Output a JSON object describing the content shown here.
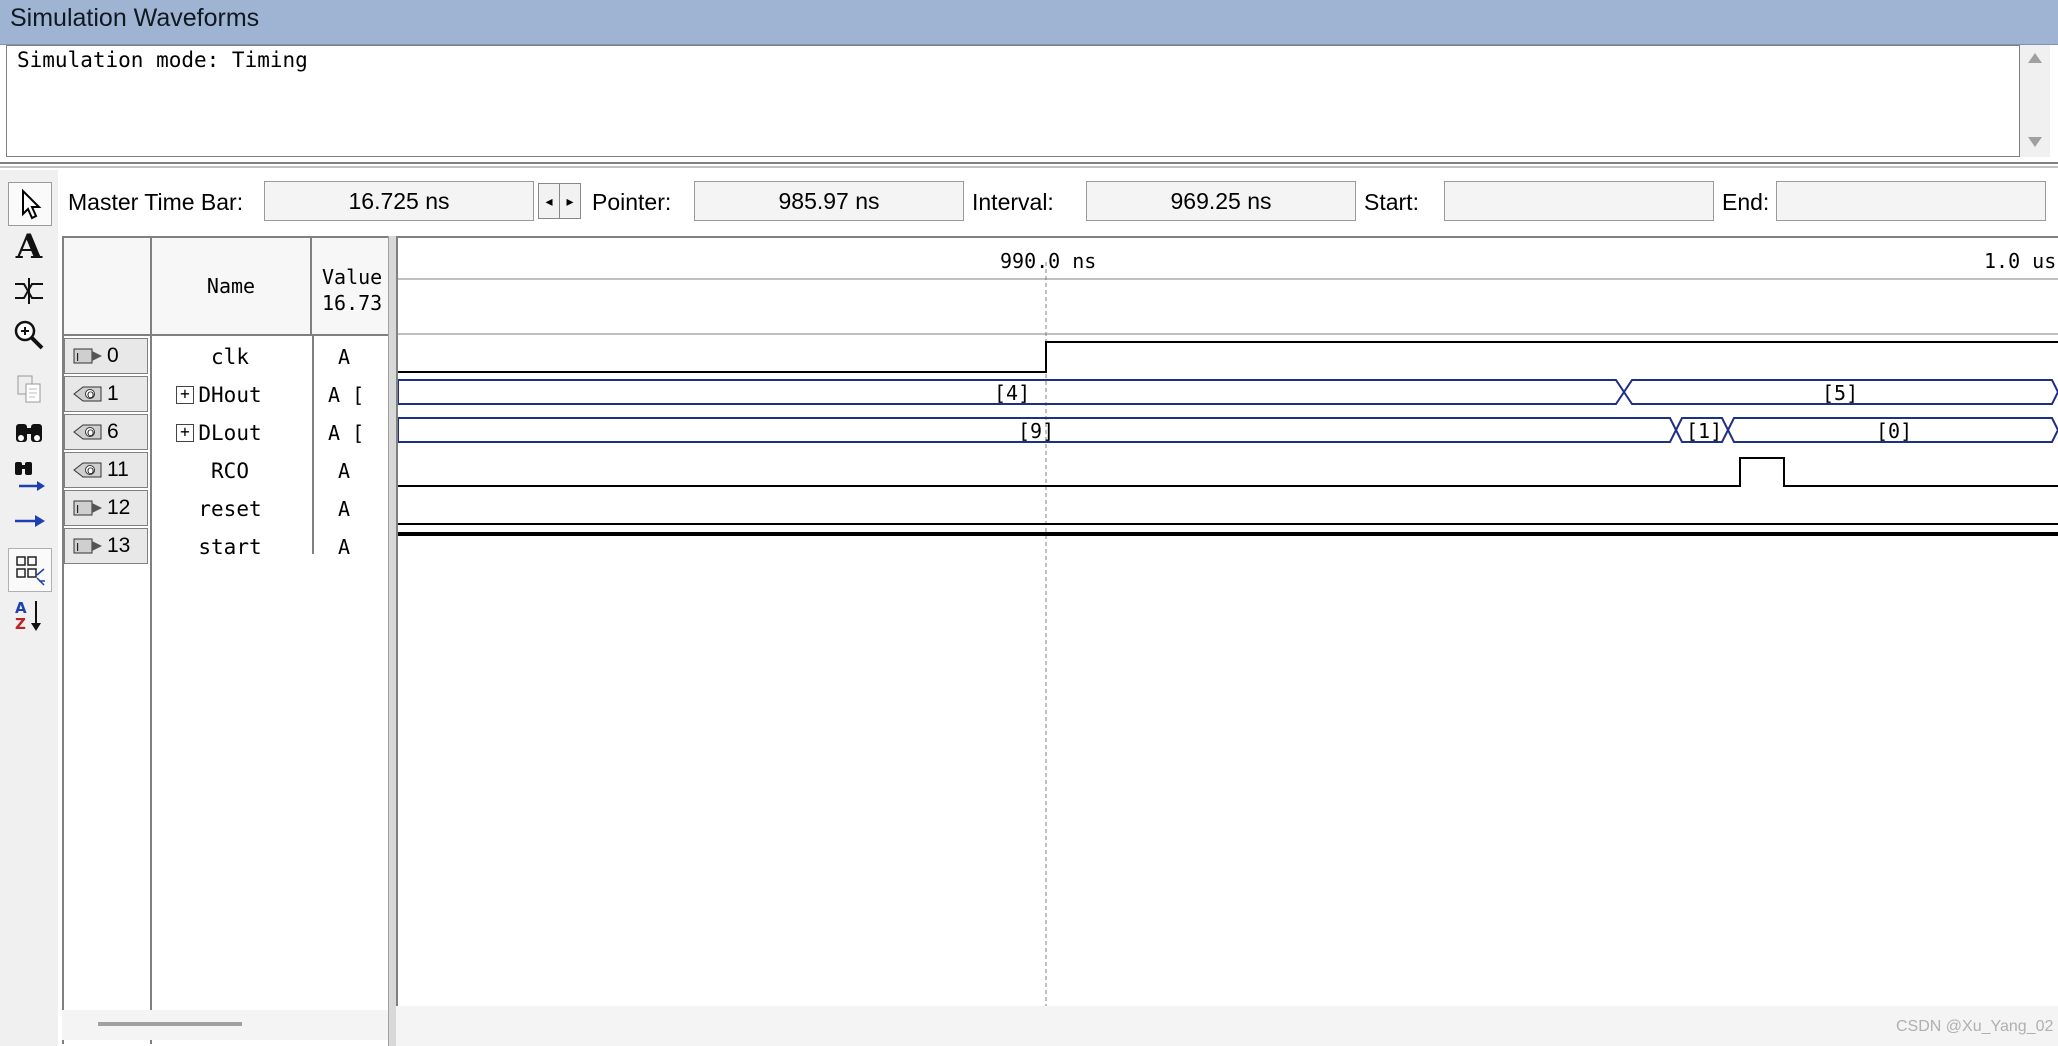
{
  "window": {
    "title": "Simulation Waveforms"
  },
  "messages": {
    "text": "Simulation mode: Timing"
  },
  "timebar": {
    "master_label": "Master Time Bar:",
    "master_value": "16.725 ns",
    "pointer_label": "Pointer:",
    "pointer_value": "985.97 ns",
    "interval_label": "Interval:",
    "interval_value": "969.25 ns",
    "start_label": "Start:",
    "start_value": "",
    "end_label": "End:",
    "end_value": ""
  },
  "grid": {
    "name_header": "Name",
    "value_header": "Value",
    "value_sub": "16.73"
  },
  "signals": [
    {
      "index": "0",
      "name": "clk",
      "value": "A",
      "dir": "input",
      "expandable": false
    },
    {
      "index": "1",
      "name": "DHout",
      "value": "A [",
      "dir": "output",
      "expandable": true
    },
    {
      "index": "6",
      "name": "DLout",
      "value": "A [",
      "dir": "output",
      "expandable": true
    },
    {
      "index": "11",
      "name": "RCO",
      "value": "A",
      "dir": "output",
      "expandable": false
    },
    {
      "index": "12",
      "name": "reset",
      "value": "A",
      "dir": "input",
      "expandable": false
    },
    {
      "index": "13",
      "name": "start",
      "value": "A",
      "dir": "input",
      "expandable": false
    }
  ],
  "waveform": {
    "cursor_label": "990.0 ns",
    "end_label": "1.0 us",
    "bus_values": {
      "dhout": [
        "[4]",
        "[5]"
      ],
      "dlout": [
        "[9]",
        "[1]",
        "[0]"
      ]
    }
  },
  "icons": {
    "tools": [
      "pointer-icon",
      "text-icon",
      "waveform-edit-icon",
      "zoom-icon",
      "copy-icon",
      "find-icon",
      "find-next-icon",
      "goto-icon",
      "group-icon",
      "sort-icon"
    ]
  },
  "watermark": "CSDN @Xu_Yang_02",
  "colors": {
    "title_bg": "#9fb4d3",
    "bus_line": "#1f2f88",
    "signal_line": "#000000"
  }
}
